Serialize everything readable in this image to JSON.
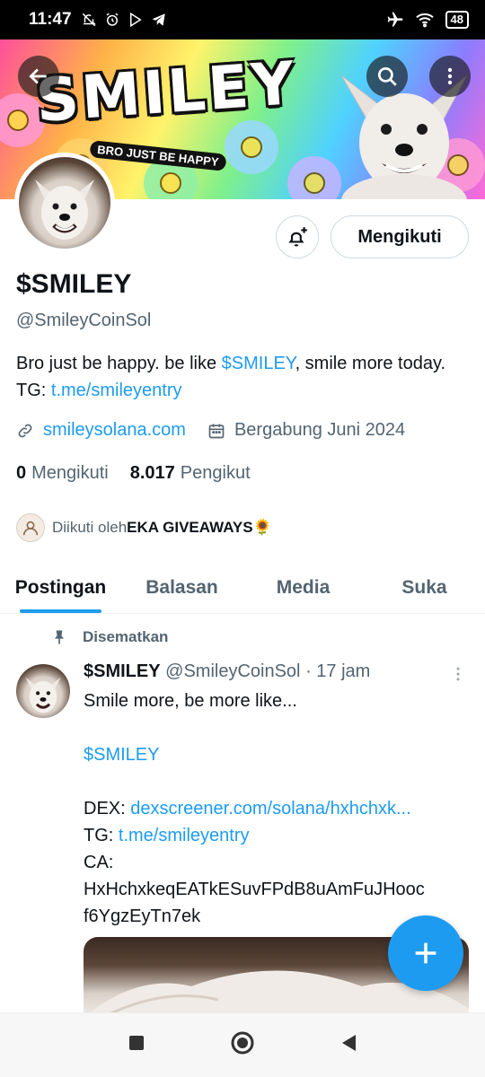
{
  "status_bar": {
    "time": "11:47",
    "battery": "48"
  },
  "banner": {
    "title": "SMILEY",
    "subtitle": "BRO JUST BE HAPPY"
  },
  "actions": {
    "follow_label": "Mengikuti"
  },
  "profile": {
    "name": "$SMILEY",
    "handle": "@SmileyCoinSol",
    "bio_part1": "Bro just be happy. be like ",
    "bio_cashtag": "$SMILEY",
    "bio_part2": ", smile more today.  TG: ",
    "bio_link": "t.me/smileyentry",
    "website": "smileysolana.com",
    "joined": "Bergabung Juni 2024",
    "following_count": "0",
    "following_label": "Mengikuti",
    "followers_count": "8.017",
    "followers_label": "Pengikut",
    "followed_by_prefix": "Diikuti oleh ",
    "followed_by_name": "EKA GIVEAWAYS🌻"
  },
  "tabs": [
    {
      "label": "Postingan",
      "active": true
    },
    {
      "label": "Balasan",
      "active": false
    },
    {
      "label": "Media",
      "active": false
    },
    {
      "label": "Suka",
      "active": false
    }
  ],
  "post": {
    "pinned_label": "Disematkan",
    "author_name": "$SMILEY",
    "author_handle": "@SmileyCoinSol",
    "time": "· 17 jam",
    "line1": "Smile more, be more like...",
    "cashtag": "$SMILEY",
    "dex_label": "DEX: ",
    "dex_link": "dexscreener.com/solana/hxhchxk...",
    "tg_label": "TG: ",
    "tg_link": "t.me/smileyentry",
    "ca_label": "CA:",
    "ca_line1": "HxHchxkeqEATkESuvFPdB8uAmFuJHooc",
    "ca_line2": "f6YgzEyTn7ek"
  },
  "colors": {
    "accent": "#1d9bf0",
    "text": "#0f1419",
    "muted": "#536471"
  }
}
